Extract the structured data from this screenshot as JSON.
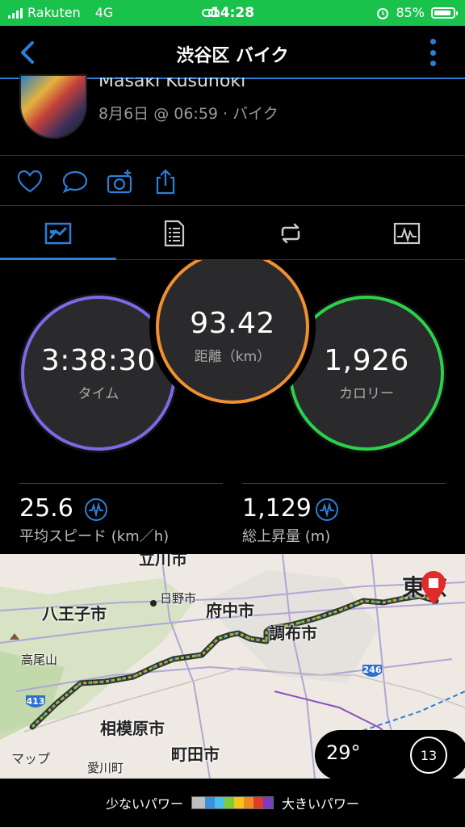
{
  "status_bar": {
    "carrier": "Rakuten",
    "network": "4G",
    "time": "14:28",
    "battery": "85%"
  },
  "header": {
    "title": "渋谷区 バイク"
  },
  "profile": {
    "name": "Masaki Kusunoki",
    "meta": "8月6日 @ 06:59 · バイク"
  },
  "actions": [
    "heart-icon",
    "comment-icon",
    "camera-add-icon",
    "share-icon"
  ],
  "tabs": [
    {
      "name": "overview-tab",
      "active": true
    },
    {
      "name": "details-tab",
      "active": false
    },
    {
      "name": "laps-tab",
      "active": false
    },
    {
      "name": "charts-tab",
      "active": false
    }
  ],
  "stats": {
    "time": {
      "value": "3:38:30",
      "label": "タイム",
      "color": "#7a6ae6"
    },
    "distance": {
      "value": "93.42",
      "label": "距離（km）",
      "color": "#f09030"
    },
    "calories": {
      "value": "1,926",
      "label": "カロリー",
      "color": "#2bd14a"
    }
  },
  "metrics": {
    "avg_speed": {
      "value": "25.6",
      "label": "平均スピード (km／h)"
    },
    "ascent": {
      "value": "1,129",
      "label": "総上昇量 (m)"
    }
  },
  "map": {
    "places": {
      "tachikawa": "立川市",
      "hachioji": "八王子市",
      "hino": "日野市",
      "fuchu": "府中市",
      "chofu": "調布市",
      "takao": "高尾山",
      "sagamihara": "相模原市",
      "machida": "町田市",
      "aikawa": "愛川町",
      "tokyo": "東京"
    },
    "route_shields": [
      "246",
      "413"
    ],
    "attribution": "マップ",
    "weather": {
      "temp": "29°",
      "badge": "13"
    }
  },
  "legend": {
    "low": "少ないパワー",
    "high": "大きいパワー",
    "colors": [
      "#bfbfbf",
      "#3b8fe0",
      "#49c1e6",
      "#7ecb3a",
      "#f5c518",
      "#f08a24",
      "#e23a2b",
      "#7a3dbd"
    ]
  }
}
